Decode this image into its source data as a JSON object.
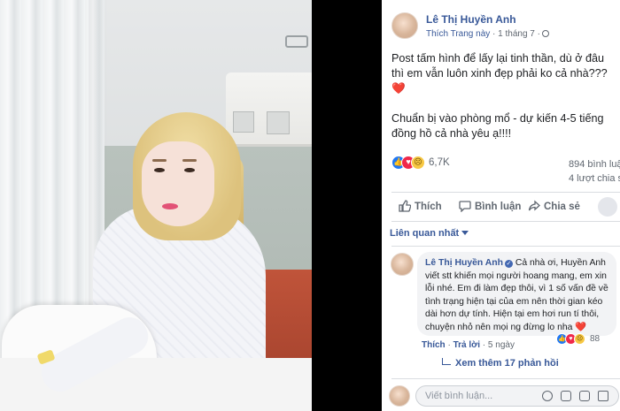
{
  "post": {
    "author": "Lê Thị Huyền Anh",
    "like_page": "Thích Trang này",
    "separator": " · ",
    "time": "1 tháng 7 ·",
    "paragraph1": "Post tấm hình để lấy lại tinh thần, dù ở đâu thì em vẫn luôn xinh đẹp phải ko cả nhà???",
    "paragraph2": "Chuẩn bị vào phòng mổ - dự kiến 4-5 tiếng đồng hồ cả nhà yêu ạ!!!!",
    "heart": "❤️",
    "reaction_count": "6,7K",
    "comment_count": "894 bình luận",
    "share_count": "4 lượt chia sẻ"
  },
  "actions": {
    "like": "Thích",
    "comment": "Bình luận",
    "share": "Chia sẻ"
  },
  "sort_label": "Liên quan nhất",
  "comment": {
    "author": "Lê Thị Huyền Anh",
    "text": "Cả nhà ơi, Huyền Anh viết stt khiến mọi người hoang mang, em xin lỗi nhé. Em đi làm đẹp thôi, vì 1 số vấn đề về tình trạng hiện tại của em nên thời gian kéo dài hơn dự tính. Hiện tại em hơi run tí thôi, chuyện nhỏ nên mọi ng đừng lo nha",
    "heart": "❤️",
    "like_label": "Thích",
    "reply_label": "Trả lời",
    "time": "5 ngày",
    "reaction_count": "88"
  },
  "more_replies": "Xem thêm 17 phản hồi",
  "write_placeholder": "Viết bình luận...",
  "colors": {
    "link": "#385898",
    "like_blue": "#2078f4",
    "love_red": "#f0284a",
    "sad_yellow": "#f7c843"
  },
  "icons": [
    "globe-icon",
    "like-icon",
    "comment-icon",
    "share-icon",
    "verified-icon",
    "reply-arrow-icon",
    "emoji-icon",
    "camera-icon",
    "gif-icon",
    "sticker-icon"
  ]
}
